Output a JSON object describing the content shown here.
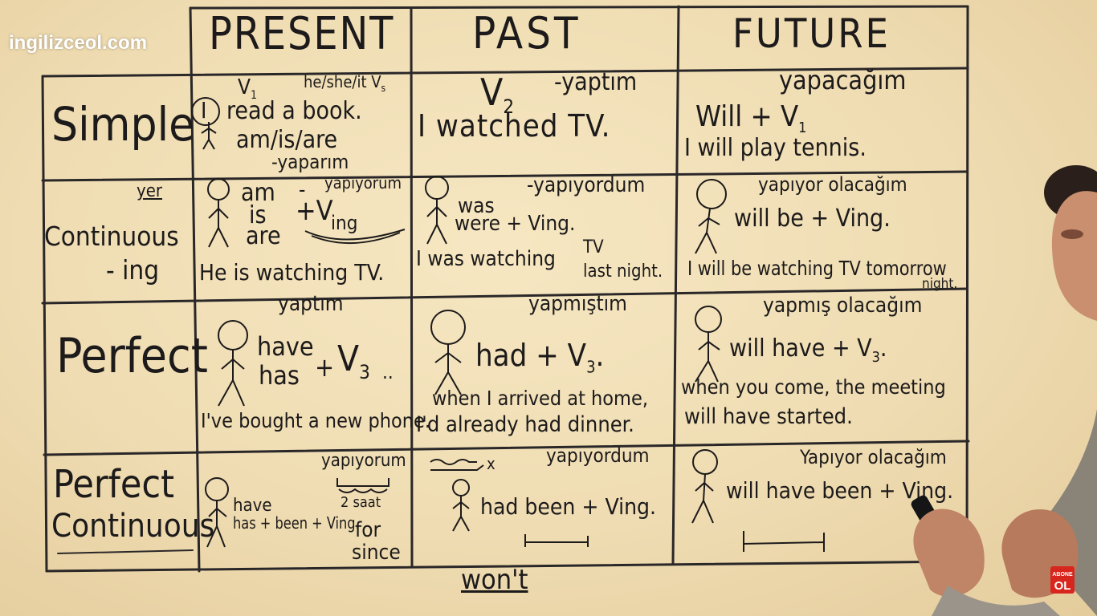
{
  "watermark": "ingilizceol.com",
  "brand_mark": "ABONE OL",
  "columns": {
    "present": "PRESENT",
    "past": "PAST",
    "future": "FUTURE"
  },
  "rows": {
    "simple": "Simple",
    "continuous": "Continuous",
    "continuous_ing": "- ing",
    "continuous_note": "yer",
    "perfect": "Perfect",
    "perfect_continuous_1": "Perfect",
    "perfect_continuous_2": "Continuous"
  },
  "cells": {
    "simple_present": {
      "v1": "V",
      "v1_sub": "1",
      "pronouns": "he/she/it V",
      "pronouns_sub": "s",
      "subject": "I",
      "sentence_rest": "read a book.",
      "be": "am/is/are",
      "tr": "-yaparım"
    },
    "simple_past": {
      "v2": "V",
      "v2_sub": "2",
      "tr": "-yaptım",
      "sentence": "I watched TV."
    },
    "simple_future": {
      "tr": "yapacağım",
      "formula": "Will + V",
      "formula_sub": "1",
      "sentence": "I will play tennis."
    },
    "cont_present": {
      "am": "am",
      "dash": "-",
      "tr": "yapıyorum",
      "is": "is",
      "are": "are",
      "plus_v": "+V",
      "ing": "ing",
      "sentence": "He is watching TV."
    },
    "cont_past": {
      "tr": "-yapıyordum",
      "was": "was",
      "were": "were + Ving.",
      "sentence": "I was watching",
      "tv": "TV",
      "last_night": "last night."
    },
    "cont_future": {
      "tr": "yapıyor olacağım",
      "formula": "will be + Ving.",
      "sentence": "I will be watching TV tomorrow",
      "night": "night."
    },
    "perf_present": {
      "tr": "yaptım",
      "have": "have",
      "has": "has",
      "plus": "+",
      "v3": "V",
      "v3_sub": "3",
      "dots": "..",
      "sentence": "I've bought a new phone."
    },
    "perf_past": {
      "tr": "yapmıştım",
      "formula": "had + V",
      "formula_sub": "3",
      "dot": ".",
      "sentence_1": "when I arrived at home,",
      "sentence_2": "I'd already had dinner."
    },
    "perf_future": {
      "tr": "yapmış olacağım",
      "formula": "will have + V",
      "formula_sub": "3",
      "dot": ".",
      "sentence_1": "when you come, the meeting",
      "sentence_2": "will have started."
    },
    "pc_present": {
      "tr": "yapıyorum",
      "have": "have",
      "has": "has + been + Ving.",
      "saat": "2 saat",
      "for": "for",
      "since": "since"
    },
    "pc_past": {
      "tr": "yapıyordum",
      "x_mark": "x",
      "formula": "had been + Ving."
    },
    "pc_future": {
      "tr": "Yapıyor olacağım",
      "formula": "will have been + Ving."
    }
  },
  "footer_word": "won't",
  "colors": {
    "board": "#f0dfb8",
    "marker": "#1c1a1a",
    "brand_red": "#d8261e"
  }
}
